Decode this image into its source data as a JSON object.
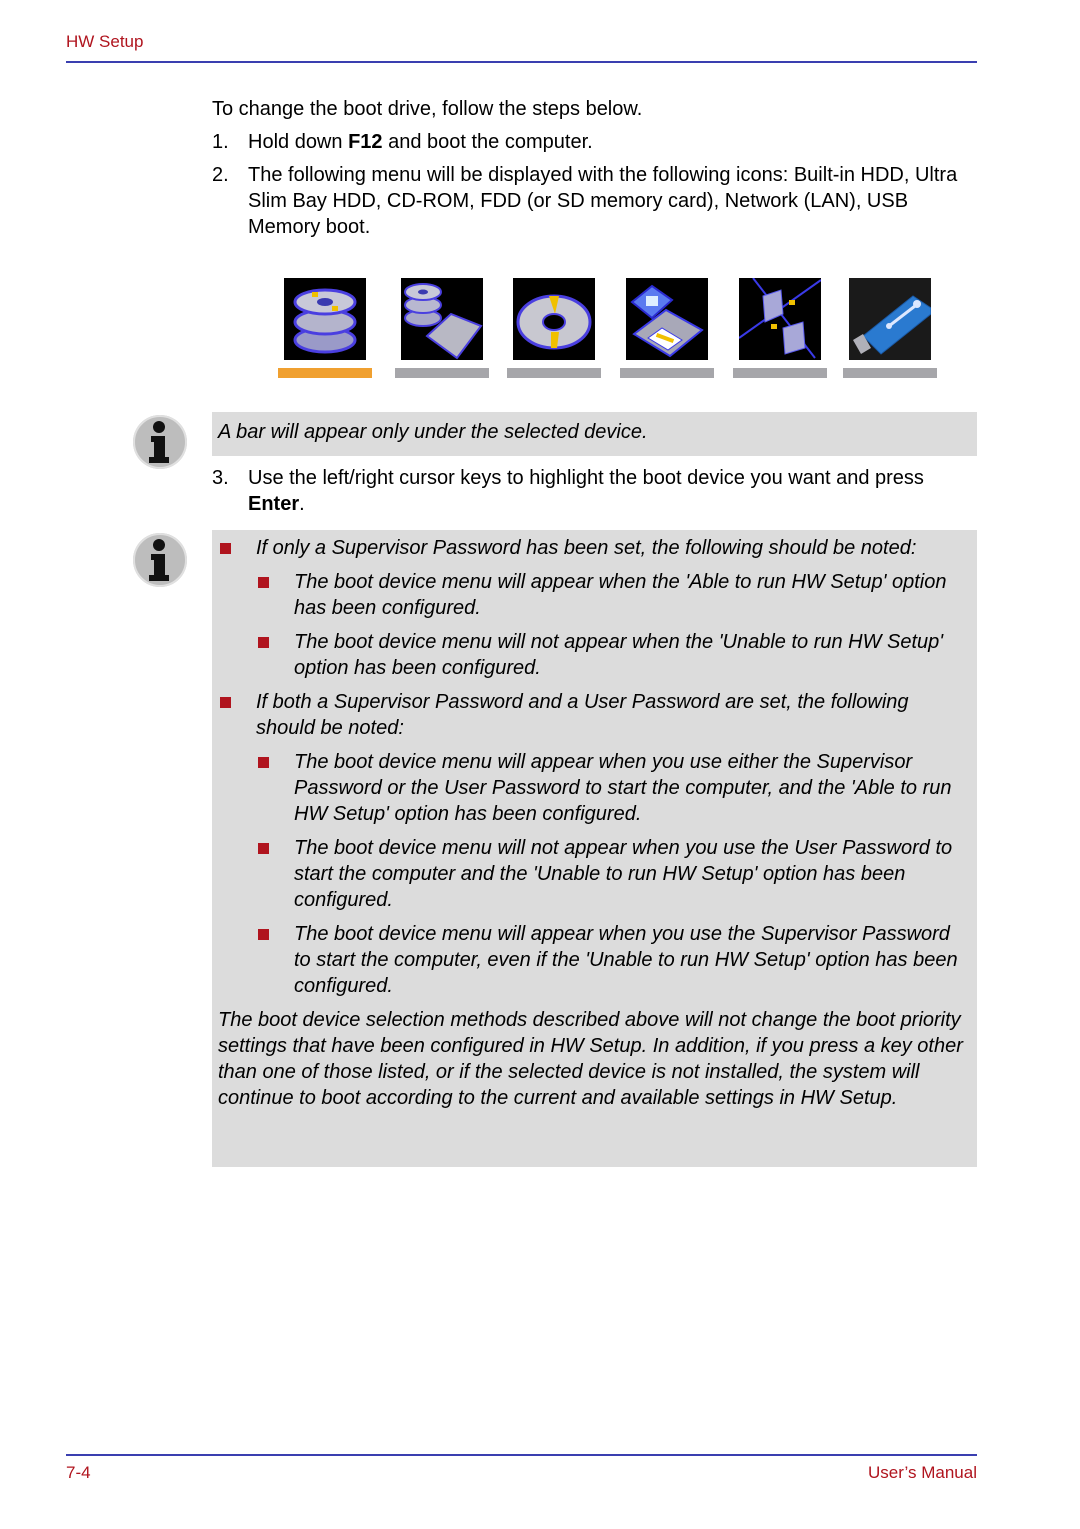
{
  "header": {
    "section_title": "HW Setup"
  },
  "footer": {
    "page_number": "7-4",
    "manual_title": "User’s Manual"
  },
  "intro": "To change the boot drive, follow the steps below.",
  "steps": [
    {
      "num": "1.",
      "pre": "Hold down ",
      "bold": "F12",
      "post": " and boot the computer."
    },
    {
      "num": "2.",
      "text": "The following menu will be displayed with the following icons: Built-in HDD, Ultra Slim Bay HDD, CD-ROM, FDD (or SD memory card), Network (LAN), USB Memory boot."
    },
    {
      "num": "3.",
      "pre": "Use the left/right cursor keys to highlight the boot device you want and press ",
      "bold": "Enter",
      "post": "."
    }
  ],
  "boot_devices": [
    {
      "name": "Built-in HDD",
      "icon": "hdd-icon",
      "selected": true
    },
    {
      "name": "Ultra Slim Bay HDD",
      "icon": "slim-bay-hdd-icon",
      "selected": false
    },
    {
      "name": "CD-ROM",
      "icon": "cd-rom-icon",
      "selected": false
    },
    {
      "name": "FDD (or SD memory card)",
      "icon": "fdd-icon",
      "selected": false
    },
    {
      "name": "Network (LAN)",
      "icon": "network-icon",
      "selected": false
    },
    {
      "name": "USB Memory",
      "icon": "usb-memory-icon",
      "selected": false
    }
  ],
  "colors": {
    "selected_bar": "#f0a030",
    "unselected_bar": "#a6a6aa",
    "accent_red": "#b0141e",
    "rule_blue": "#3a3fb0",
    "note_bg": "#dcdcdc"
  },
  "note1": "A bar will appear only under the selected device.",
  "note2": {
    "bullets": [
      {
        "text": "If only a Supervisor Password has been set, the following should be noted:",
        "sub": [
          "The boot device menu will appear when the 'Able to run HW Setup' option has been configured.",
          "The boot device menu will not appear when the 'Unable to run HW Setup' option has been configured."
        ]
      },
      {
        "text": "If both a Supervisor Password and a User Password are set, the following should be noted:",
        "sub": [
          "The boot device menu will appear when you use either the Supervisor Password or the User Password to start the computer, and the 'Able to run HW Setup' option has been configured.",
          "The boot device menu will not appear when you use the User Password to start the computer and the 'Unable to run HW Setup' option has been configured.",
          "The boot device menu will appear when you use the Supervisor Password to start the computer, even if the 'Unable to run HW Setup' option has been configured."
        ]
      }
    ],
    "closing": "The boot device selection methods described above will not change the boot priority settings that have been configured in HW Setup. In addition, if you press a key other than one of those listed, or if the selected device is not installed, the system will continue to boot according to the current and available settings in HW Setup."
  }
}
